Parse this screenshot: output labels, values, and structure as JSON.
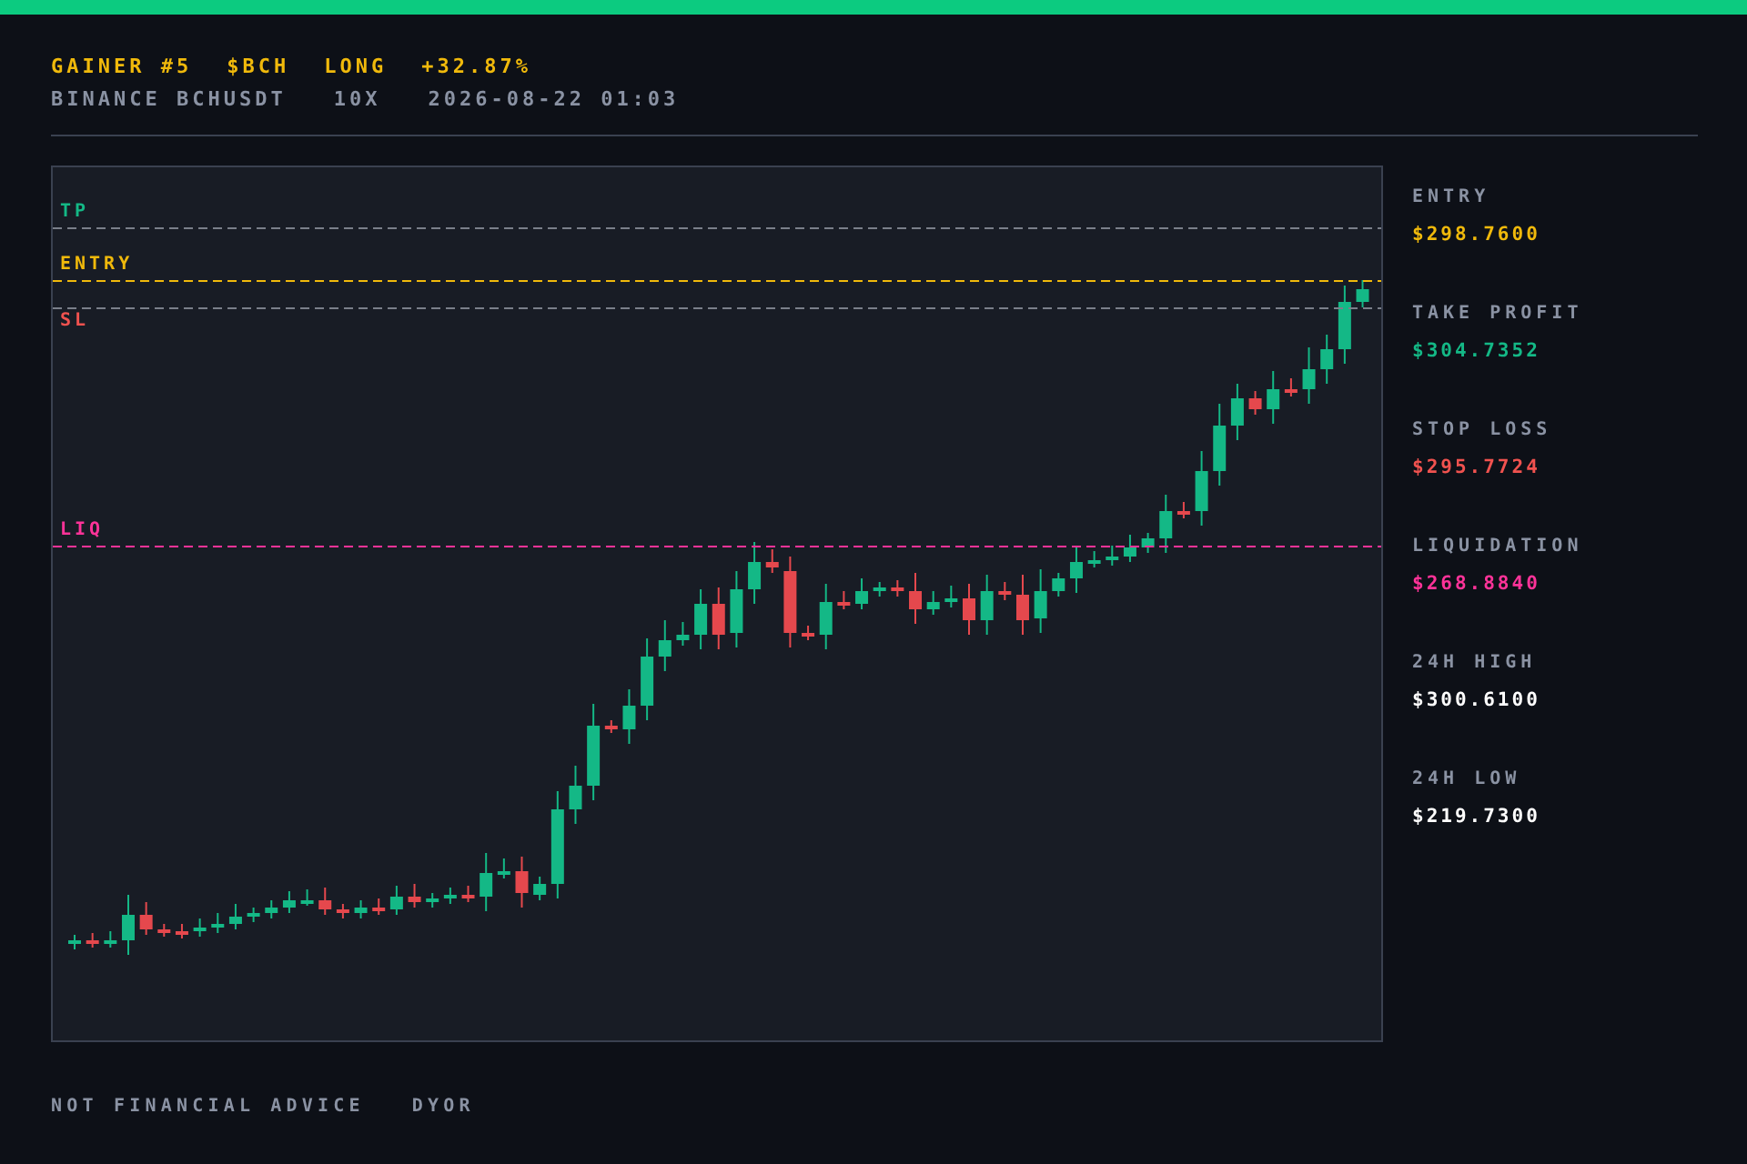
{
  "header": {
    "title_parts": [
      "GAINER #5",
      "$BCH",
      "LONG",
      "+32.87%"
    ],
    "meta": [
      "BINANCE BCHUSDT",
      "10X",
      "2026-08-22 01:03"
    ]
  },
  "chart": {
    "levels": [
      {
        "kind": "tp",
        "label": "TP",
        "color": "#14b886"
      },
      {
        "kind": "entry",
        "label": "ENTRY",
        "color": "#f0b90b"
      },
      {
        "kind": "sl",
        "label": "SL",
        "color": "#f0524f"
      },
      {
        "kind": "liq",
        "label": "LIQ",
        "color": "#ff3399"
      }
    ]
  },
  "stats": [
    {
      "label": "ENTRY",
      "value": "$298.7600",
      "color": "#f0b90b"
    },
    {
      "label": "TAKE PROFIT",
      "value": "$304.7352",
      "color": "#14b886"
    },
    {
      "label": "STOP LOSS",
      "value": "$295.7724",
      "color": "#f0524f"
    },
    {
      "label": "LIQUIDATION",
      "value": "$268.8840",
      "color": "#ff3399"
    },
    {
      "label": "24H HIGH",
      "value": "$300.6100",
      "color": "#ffffff"
    },
    {
      "label": "24H LOW",
      "value": "$219.7300",
      "color": "#ffffff"
    }
  ],
  "footer": [
    "NOT FINANCIAL ADVICE",
    "DYOR"
  ]
}
